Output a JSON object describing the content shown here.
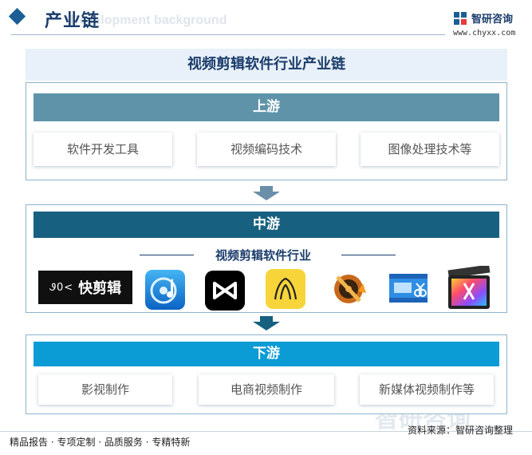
{
  "header": {
    "title": "产业链",
    "subtitle": "Development background",
    "brand_name": "智研咨询",
    "brand_url": "www.chyxx.com"
  },
  "main_title": "视频剪辑软件行业产业链",
  "upstream": {
    "title": "上游",
    "items": [
      "软件开发工具",
      "视频编码技术",
      "图像处理技术等"
    ]
  },
  "midstream": {
    "title": "中游",
    "industry_label": "视频剪辑软件行业",
    "logos": [
      {
        "name": "kuaijianji-logo",
        "text": "快剪辑",
        "prefix": "Ꮽ0<"
      },
      {
        "name": "blue-media-app-logo"
      },
      {
        "name": "capcut-logo"
      },
      {
        "name": "yellow-flower-app-logo"
      },
      {
        "name": "film-reel-app-logo"
      },
      {
        "name": "video-scissors-app-logo"
      },
      {
        "name": "final-cut-pro-logo"
      }
    ]
  },
  "downstream": {
    "title": "下游",
    "items": [
      "影视制作",
      "电商视频制作",
      "新媒体视频制作等"
    ]
  },
  "footer": {
    "left": "精品报告 · 专项定制 · 品质服务 · 专精特新",
    "source": "资料来源：智研咨询整理"
  },
  "watermark": "智研咨询",
  "colors": {
    "upstream_bar": "#5f93a9",
    "midstream_bar": "#18607f",
    "downstream_bar": "#0b9bd5",
    "title": "#1b3c6b"
  }
}
